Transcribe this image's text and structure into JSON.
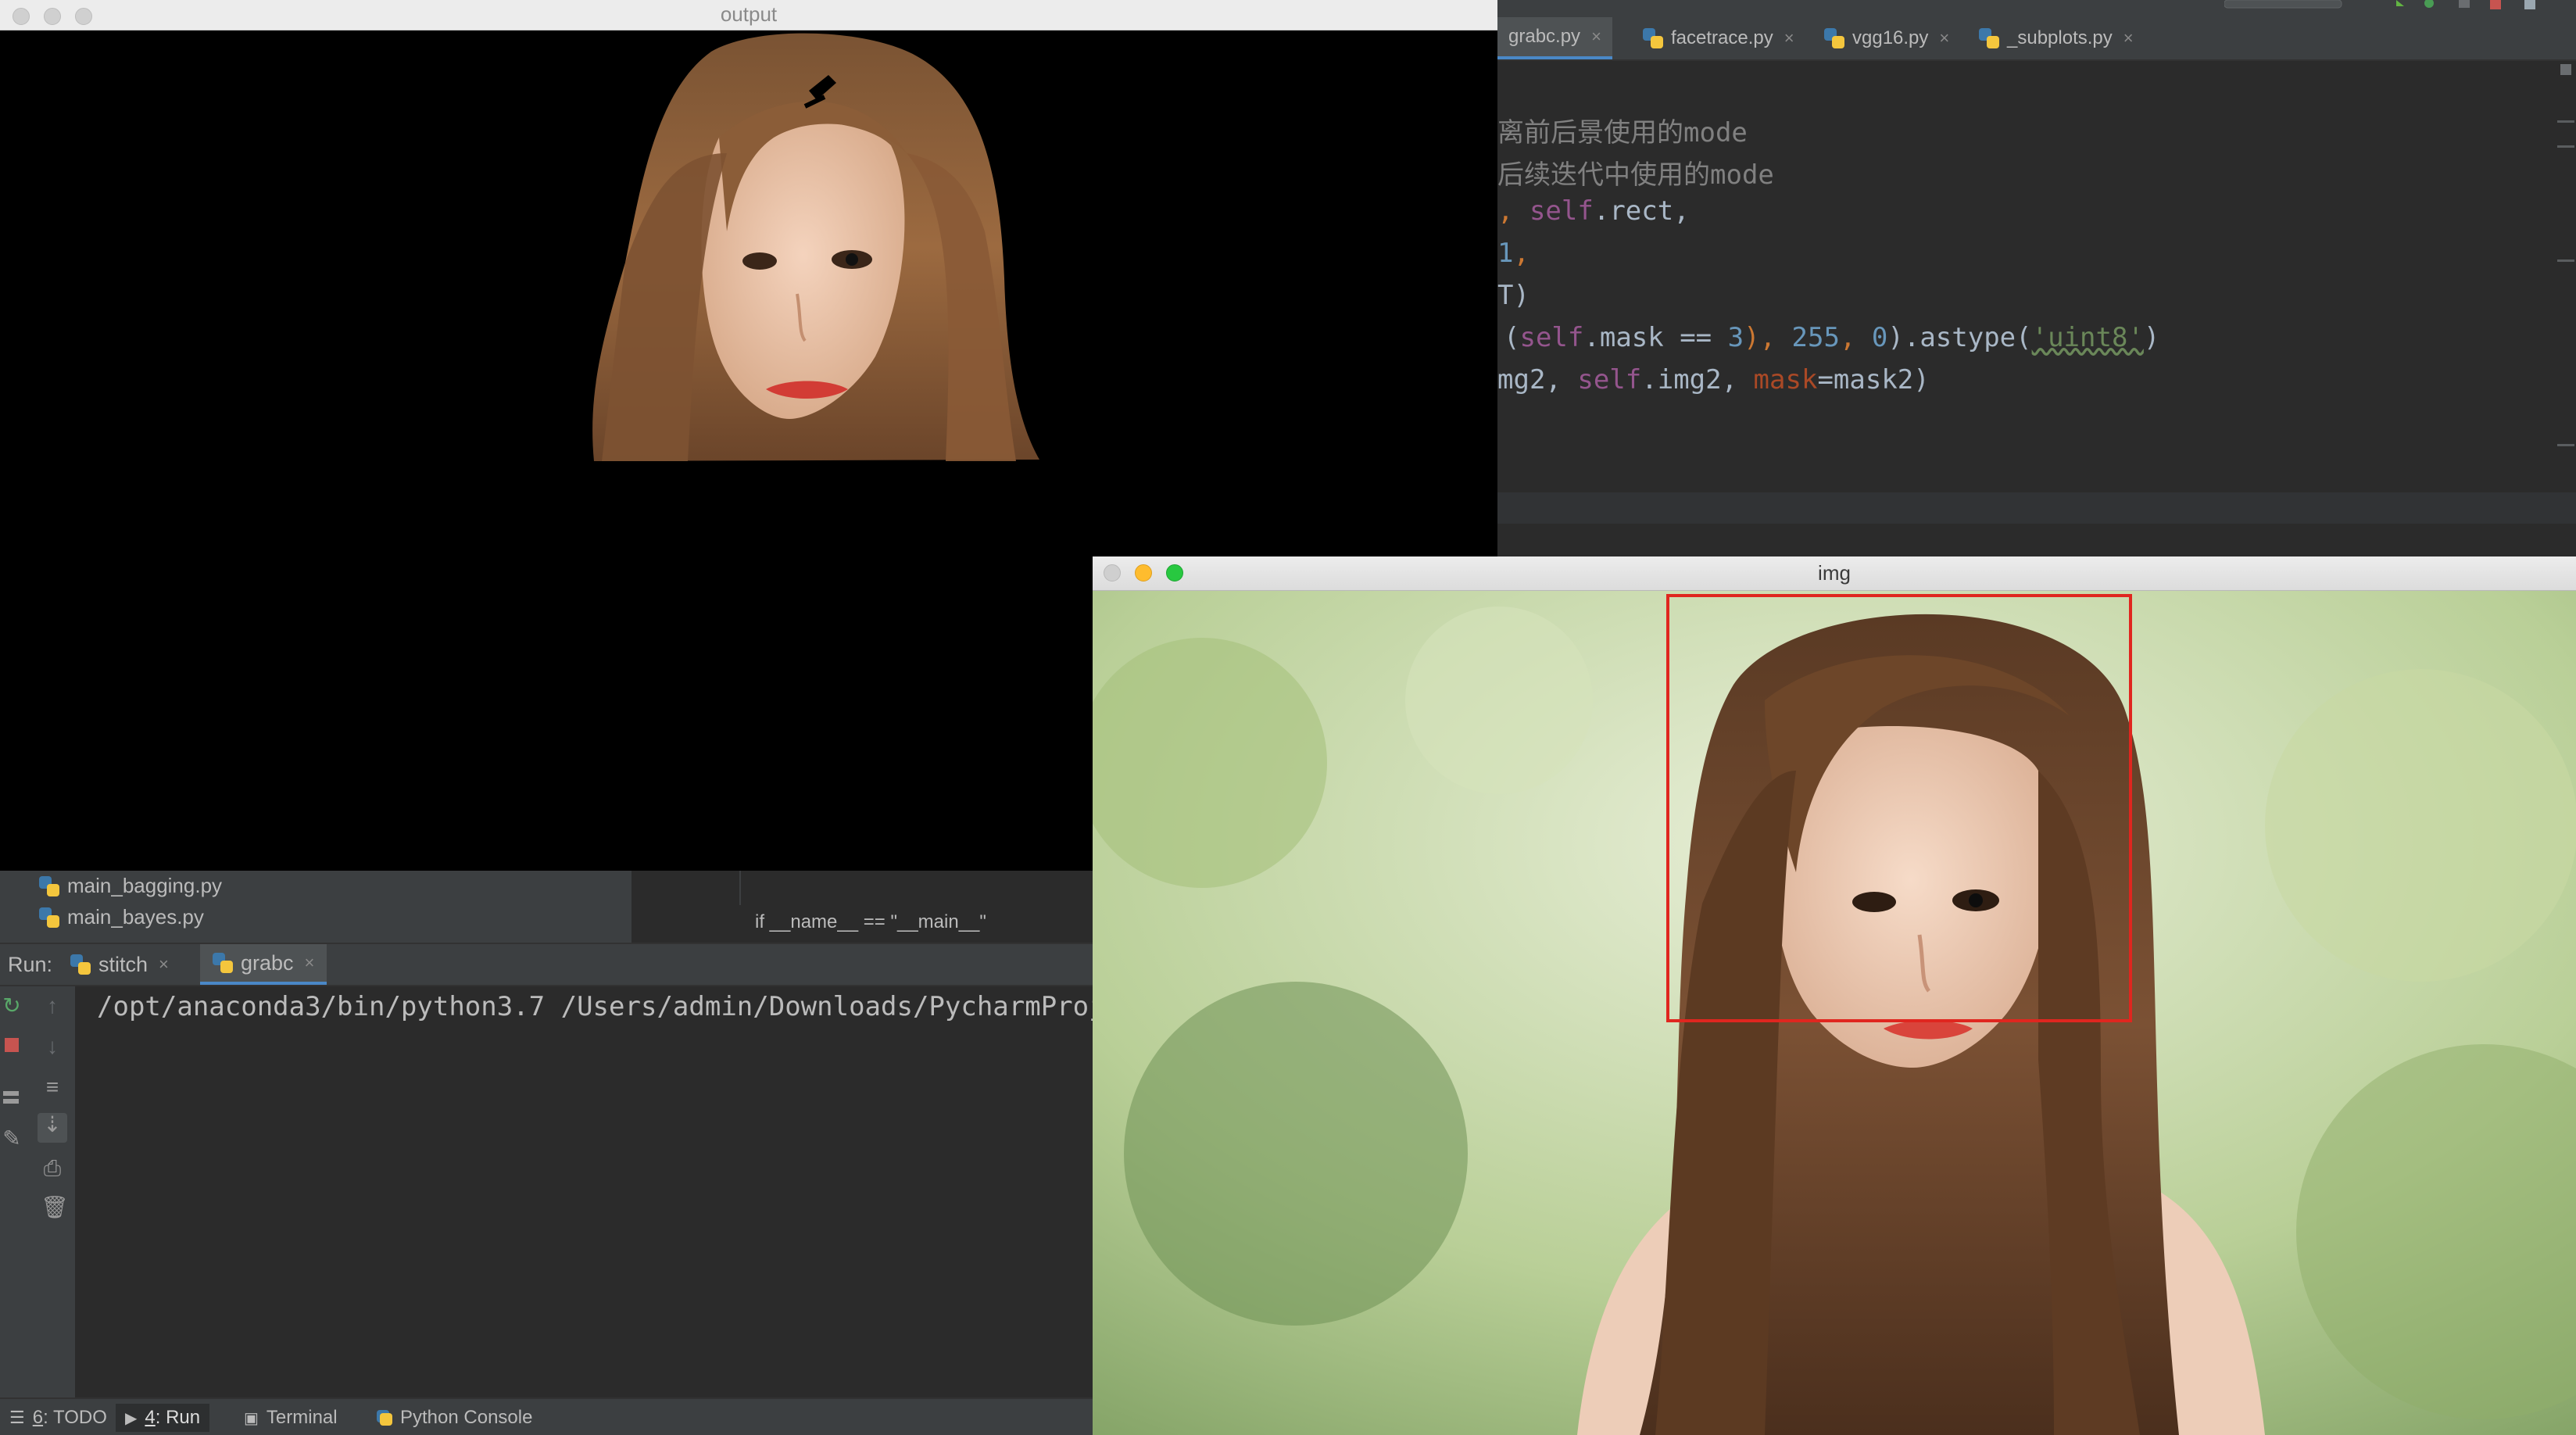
{
  "output_window": {
    "title": "output"
  },
  "img_window": {
    "title": "img"
  },
  "editor": {
    "tabs": [
      {
        "label": "grabc.py",
        "active": true
      },
      {
        "label": "facetrace.py",
        "active": false
      },
      {
        "label": "vgg16.py",
        "active": false
      },
      {
        "label": "_subplots.py",
        "active": false
      }
    ],
    "code": {
      "l1": "离前后景使用的mode",
      "l2": "后续迭代中使用的mode",
      "l3a": ", ",
      "l3b": "self",
      "l3c": ".rect,",
      "l4a": "1",
      "l4b": ",",
      "l5": "T)",
      "l6a": "(",
      "l6b": "self",
      "l6c": ".mask == ",
      "l6d": "3",
      "l6e": "), ",
      "l6f": "255",
      "l6g": ", ",
      "l6h": "0",
      "l6i": ").astype(",
      "l6j": "'uint8'",
      "l6k": ")",
      "l7a": "mg2, ",
      "l7b": "self",
      "l7c": ".img2, ",
      "l7d": "mask",
      "l7e": "=mask2)"
    }
  },
  "project": {
    "files": [
      "main_bagging.py",
      "main_bayes.py"
    ],
    "breadcrumb": "if __name__ == \"__main__\""
  },
  "run": {
    "label": "Run:",
    "tabs": [
      {
        "label": "stitch",
        "active": false
      },
      {
        "label": "grabc",
        "active": true
      }
    ],
    "console_line": "/opt/anaconda3/bin/python3.7 /Users/admin/Downloads/PycharmProje"
  },
  "status_bar": {
    "items": [
      {
        "num": "6",
        "label": ": TODO"
      },
      {
        "num": "4",
        "label": ": Run"
      },
      {
        "num": "",
        "label": "Terminal"
      },
      {
        "num": "",
        "label": "Python Console"
      }
    ]
  },
  "colors": {
    "accent": "#4a88c7",
    "face_box": "#e0261f",
    "traffic_red": "#ff5f57",
    "traffic_yellow": "#febc2e",
    "traffic_green": "#28c840"
  }
}
